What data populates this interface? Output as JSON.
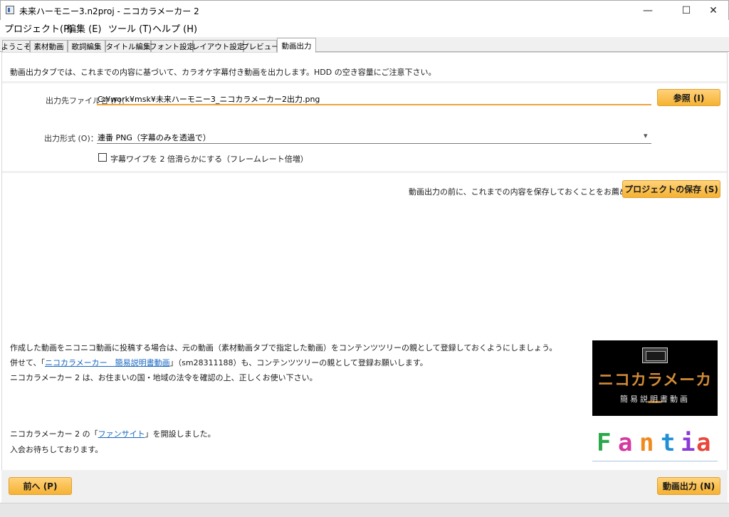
{
  "window": {
    "title": "未来ハーモニー3.n2proj - ニコカラメーカー 2",
    "minimize": "—",
    "maximize": "☐",
    "close": "✕"
  },
  "menu": {
    "project": "プロジェクト(P)",
    "edit": "編集 (E)",
    "tool": "ツール (T)",
    "help": "ヘルプ (H)"
  },
  "tabs": [
    {
      "label": "ようこそ"
    },
    {
      "label": "素材動画"
    },
    {
      "label": "歌詞編集"
    },
    {
      "label": "タイトル編集"
    },
    {
      "label": "フォント設定"
    },
    {
      "label": "レイアウト設定"
    },
    {
      "label": "プレビュー"
    },
    {
      "label": "動画出力",
      "active": true
    }
  ],
  "intro": "動画出力タブでは、これまでの内容に基づいて、カラオケ字幕付き動画を出力します。HDD の空き容量にご注意下さい。",
  "output_file": {
    "label": "出力先ファイル名 (F)：",
    "value": "C:¥work¥msk¥未来ハーモニー3_ニコカラメーカー2出力.png",
    "browse_button": "参照 (I)"
  },
  "output_format": {
    "label": "出力形式 (O)：",
    "value": "連番 PNG（字幕のみを透過で）",
    "dropdown_arrow": "▾"
  },
  "wipe_option": {
    "label": "字幕ワイプを 2 倍滑らかにする（フレームレート倍増）",
    "checked": false
  },
  "save_hint": "動画出力の前に、これまでの内容を保存しておくことをお薦めします。",
  "save_button": "プロジェクトの保存 (S)",
  "notes": {
    "line1": "作成した動画をニコニコ動画に投稿する場合は、元の動画（素材動画タブで指定した動画）をコンテンツツリーの親として登録しておくようにしましょう。",
    "line2_prefix": "併せて、「",
    "line2_link": "ニコカラメーカー　簡易説明書動画",
    "line2_suffix": "」（sm28311188）も、コンテンツツリーの親として登録お願いします。",
    "line3": "ニコカラメーカー 2 は、お住まいの国・地域の法令を確認の上、正しくお使い下さい。",
    "line4_prefix": "ニコカラメーカー 2 の「",
    "line4_link": "ファンサイト",
    "line4_suffix": "」を開設しました。",
    "line5": "入会お待ちしております。"
  },
  "banners": {
    "nico_logo": "ニコカラメーカー",
    "nico_sub": "簡易説明書動画",
    "fantia_letters": [
      "F",
      "a",
      "n",
      "t",
      "i",
      "a"
    ],
    "fantia_colors": [
      "#2aa84a",
      "#d63aa0",
      "#f08a1e",
      "#1f8fd6",
      "#8a3ad6",
      "#e8473a"
    ]
  },
  "footer": {
    "prev_button": "前へ (P)",
    "export_button": "動画出力 (N)"
  }
}
